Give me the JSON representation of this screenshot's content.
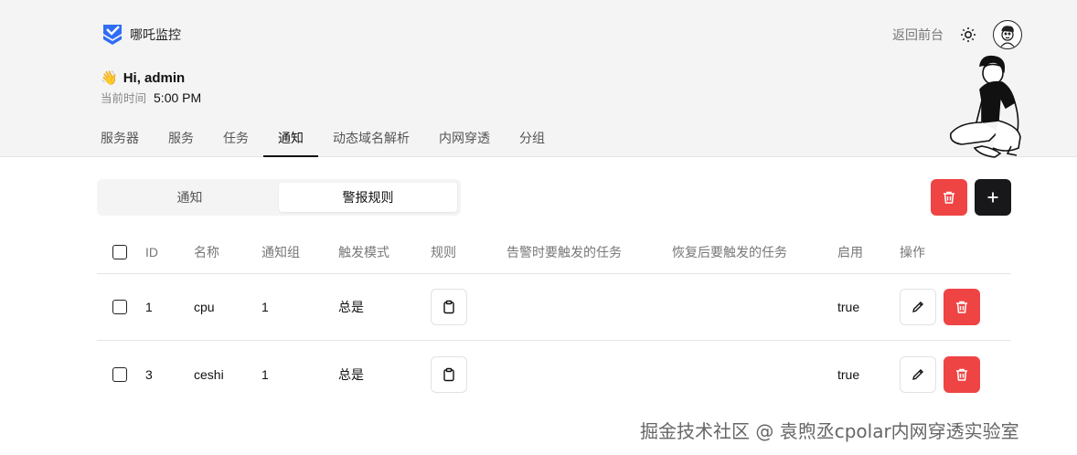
{
  "brand": {
    "name": "哪吒监控"
  },
  "header": {
    "back_link": "返回前台",
    "theme_icon": "sun-icon",
    "avatar_icon": "avatar-face-icon"
  },
  "greeting": {
    "emoji": "👋",
    "text": "Hi, admin",
    "time_label": "当前时间",
    "time_value": "5:00 PM"
  },
  "nav": {
    "tabs": [
      {
        "label": "服务器",
        "active": false
      },
      {
        "label": "服务",
        "active": false
      },
      {
        "label": "任务",
        "active": false
      },
      {
        "label": "通知",
        "active": true
      },
      {
        "label": "动态域名解析",
        "active": false
      },
      {
        "label": "内网穿透",
        "active": false
      },
      {
        "label": "分组",
        "active": false
      }
    ]
  },
  "segment": {
    "options": [
      "通知",
      "警报规则"
    ],
    "active_index": 1
  },
  "actions": {
    "delete_icon": "trash-icon",
    "add_icon": "plus-icon"
  },
  "table": {
    "headers": [
      "ID",
      "名称",
      "通知组",
      "触发模式",
      "规则",
      "告警时要触发的任务",
      "恢复后要触发的任务",
      "启用",
      "操作"
    ],
    "rows": [
      {
        "id": "1",
        "name": "cpu",
        "group": "1",
        "mode": "总是",
        "rule_icon": "clipboard-icon",
        "fail_task": "",
        "recover_task": "",
        "enabled": "true"
      },
      {
        "id": "3",
        "name": "ceshi",
        "group": "1",
        "mode": "总是",
        "rule_icon": "clipboard-icon",
        "fail_task": "",
        "recover_task": "",
        "enabled": "true"
      }
    ]
  },
  "colors": {
    "danger": "#ef4444",
    "primary": "#18181b",
    "header_bg": "#f4f4f4"
  },
  "watermark": "掘金技术社区 @ 袁煦丞cpolar内网穿透实验室"
}
